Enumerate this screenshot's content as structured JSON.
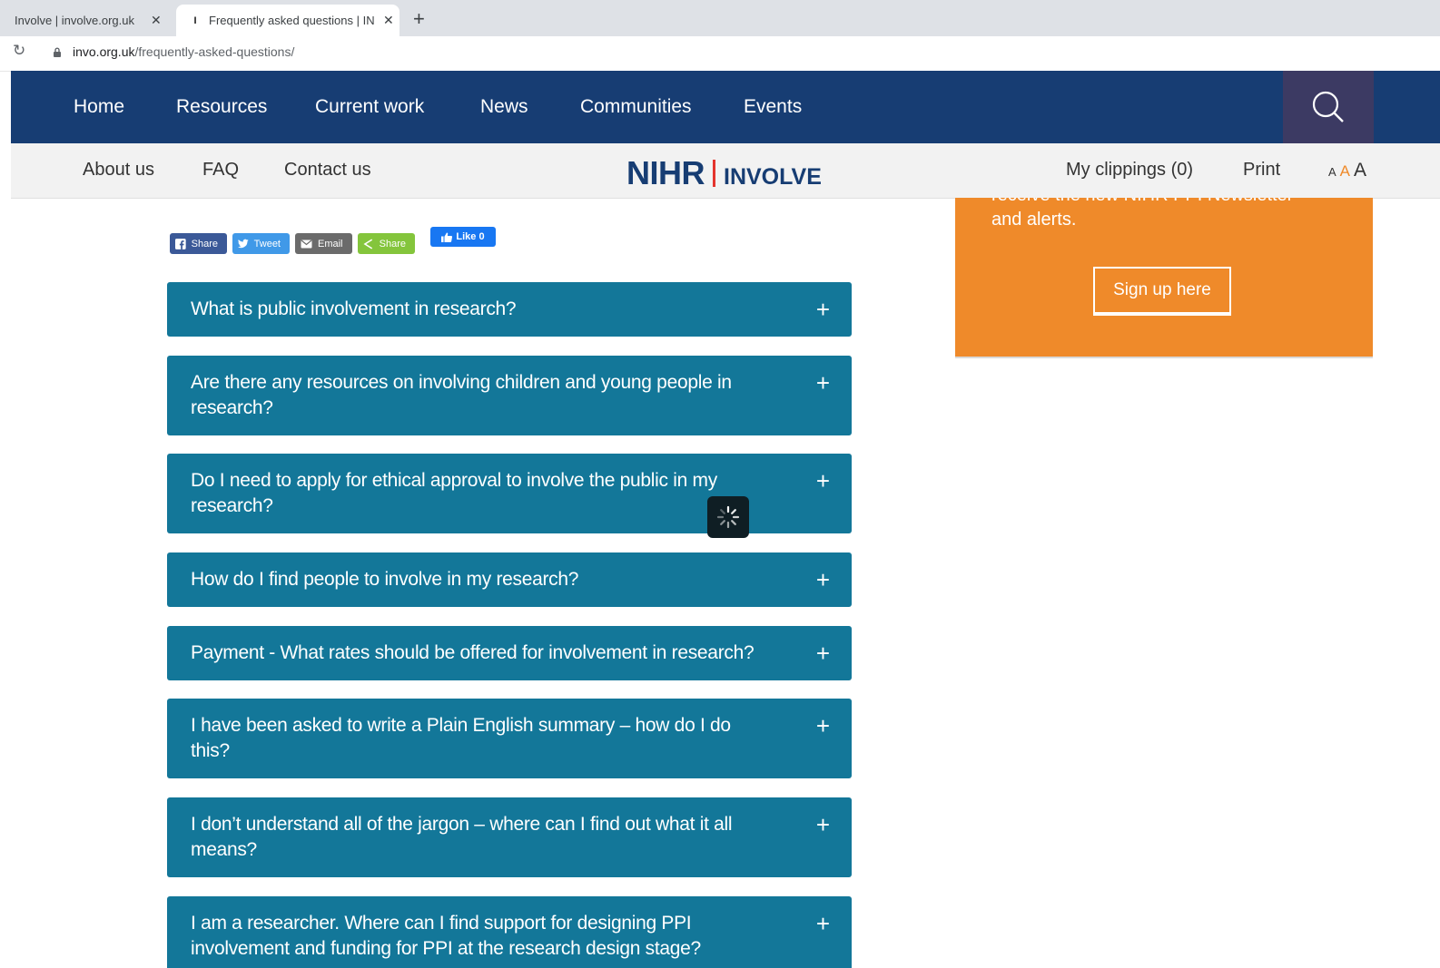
{
  "browser": {
    "tabs": [
      {
        "title": "Involve | involve.org.uk",
        "active": false
      },
      {
        "title": "Frequently asked questions | INVOLVE",
        "active": true
      }
    ],
    "new_tab": "+",
    "close": "✕",
    "url_host": "invo.org.uk",
    "url_path": "/frequently-asked-questions/"
  },
  "primary_nav": {
    "items": [
      "Home",
      "Resources",
      "Current work",
      "News",
      "Communities",
      "Events"
    ]
  },
  "secondary_nav": {
    "items": [
      "About us",
      "FAQ",
      "Contact us"
    ],
    "logo_main": "NIHR",
    "logo_sub": "INVOLVE",
    "clippings": "My clippings (0)",
    "print": "Print",
    "text_size": [
      "A",
      "A",
      "A"
    ]
  },
  "signup": {
    "clipped_text": "receive the new NIHR PPI Newsletter",
    "text": "and alerts.",
    "button": "Sign up here"
  },
  "share": {
    "facebook": "Share",
    "twitter": "Tweet",
    "email": "Email",
    "share": "Share",
    "like": "Like 0"
  },
  "faq": {
    "expand_symbol": "+",
    "items": [
      "What is public involvement in research?",
      "Are there any resources on involving children and young people in research?",
      "Do I need to apply for ethical approval to involve the public in my research?",
      "How do I find people to involve in my research?",
      "Payment - What rates should be offered for involvement in research?",
      "I have been asked to write a Plain English summary – how do I do this?",
      "I don’t understand all of the jargon – where can I find out what it all means?",
      "I am a researcher. Where can I find support for designing PPI involvement and funding for PPI at the research design stage?"
    ]
  },
  "colors": {
    "nav_primary": "#173d73",
    "search_bg": "#3c3a63",
    "accent_orange": "#ef8a2a",
    "faq_bg": "#137799",
    "logo_red": "#e4342e"
  }
}
